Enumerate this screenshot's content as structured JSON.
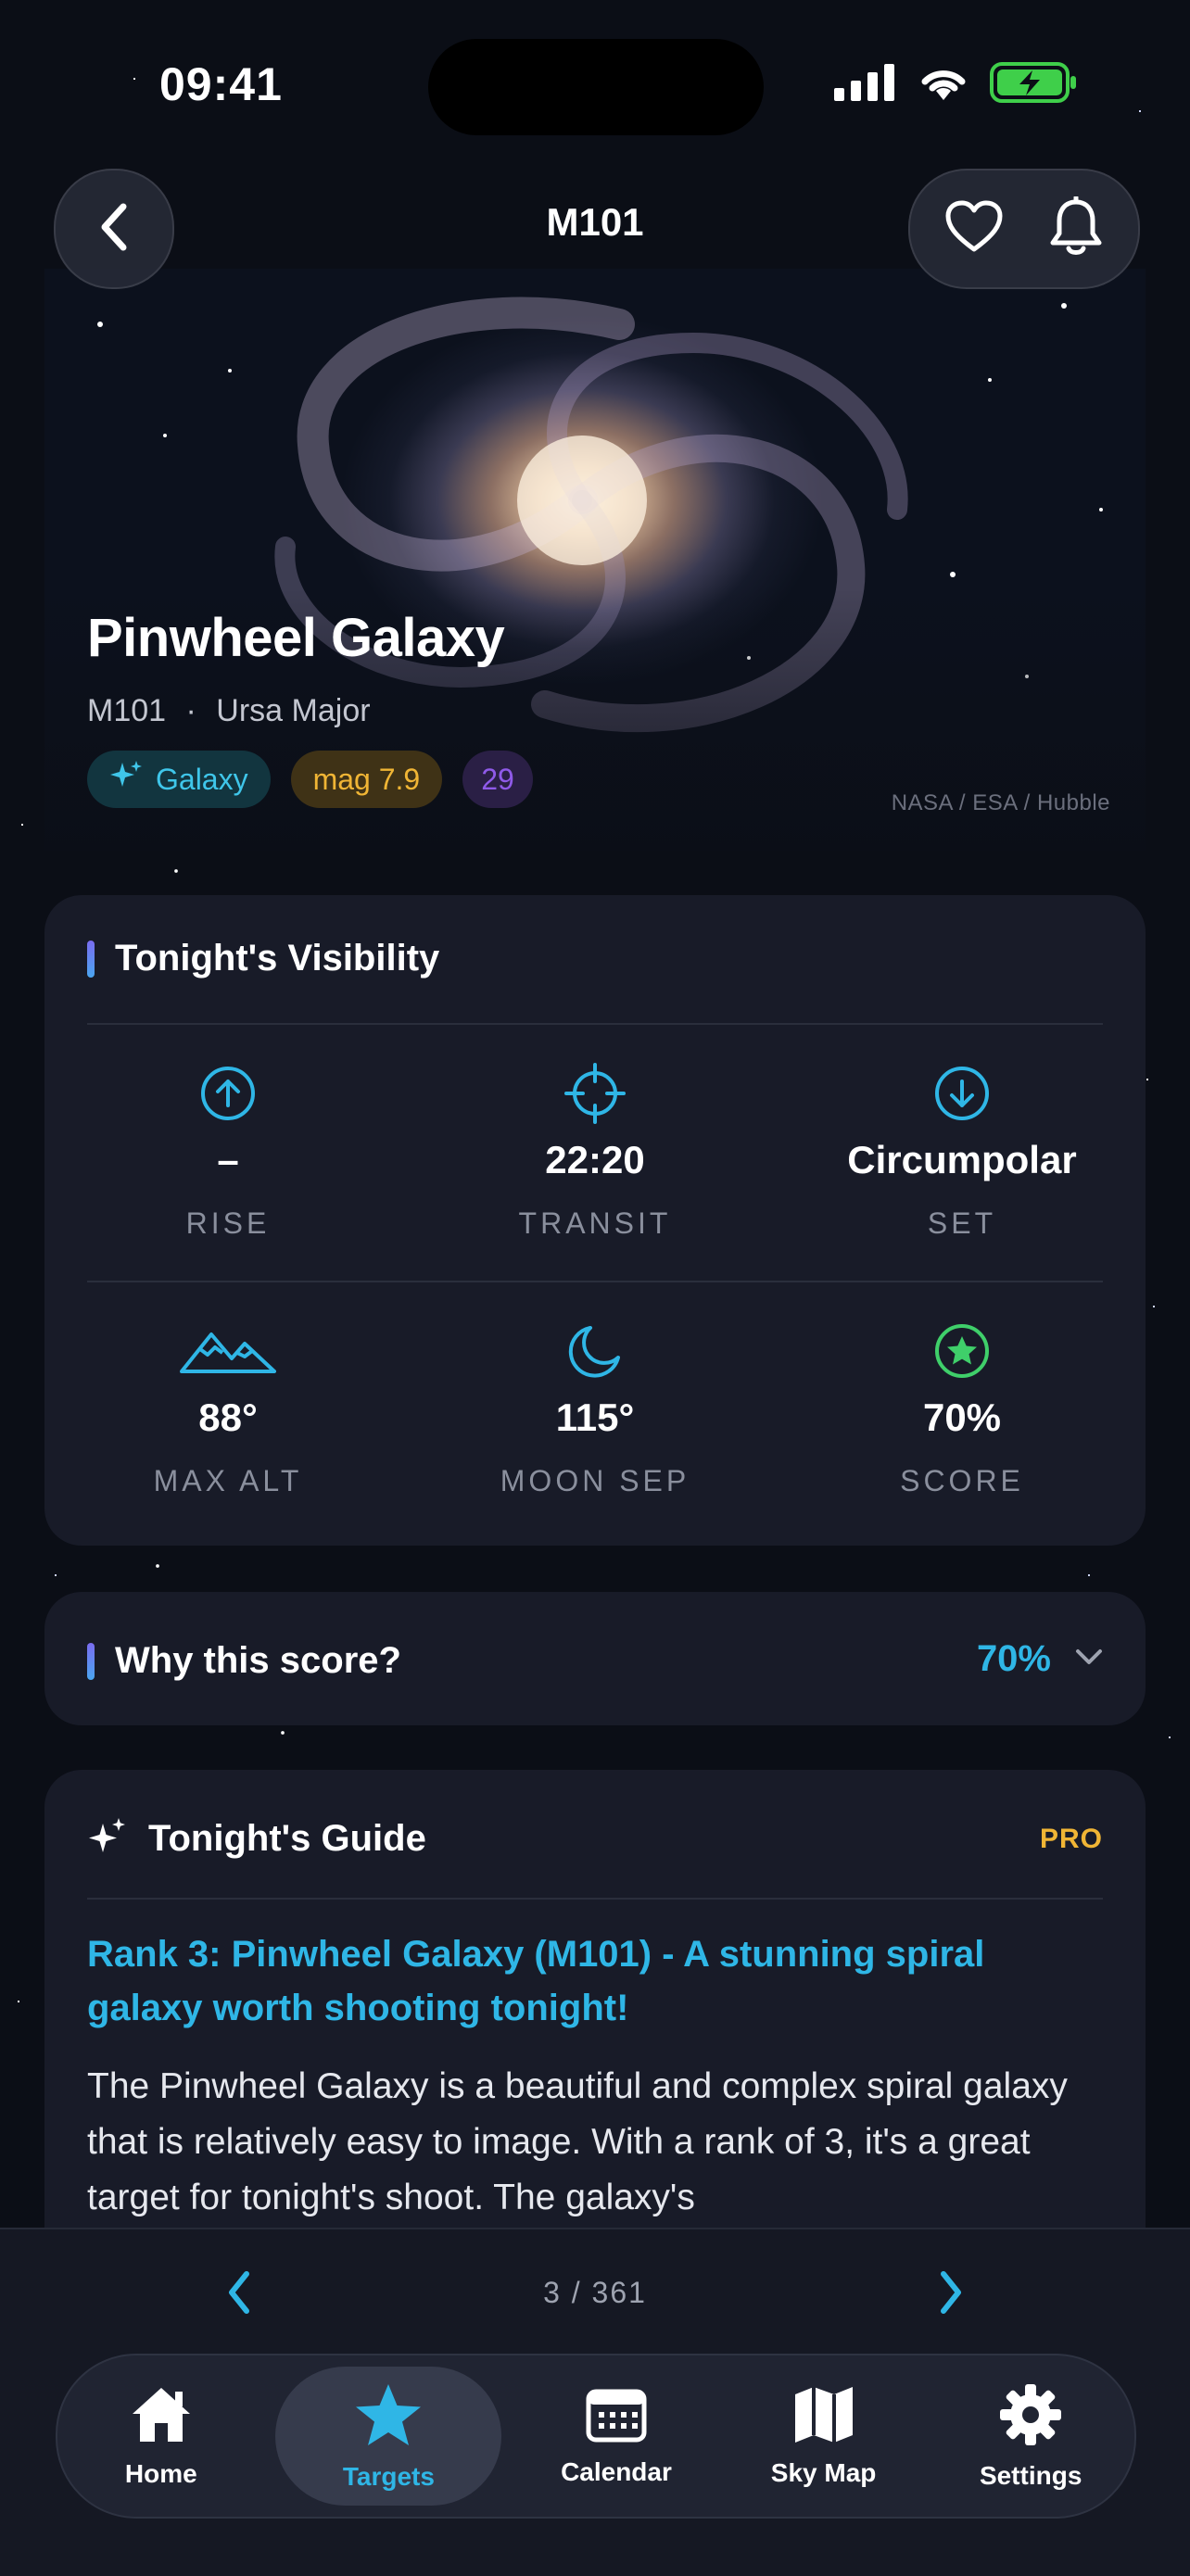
{
  "status_bar": {
    "time": "09:41"
  },
  "nav": {
    "title": "M101",
    "back_icon": "chevron-left-icon",
    "favorite_icon": "heart-icon",
    "alert_icon": "bell-icon"
  },
  "hero": {
    "title": "Pinwheel Galaxy",
    "catalog_id": "M101",
    "separator": "·",
    "constellation": "Ursa Major",
    "chips": {
      "type": "Galaxy",
      "magnitude": "mag 7.9",
      "third": "29"
    },
    "credit": "NASA / ESA / Hubble"
  },
  "visibility": {
    "title": "Tonight's Visibility",
    "row1": [
      {
        "value": "–",
        "label": "RISE",
        "icon": "arrow-up-circle-icon"
      },
      {
        "value": "22:20",
        "label": "TRANSIT",
        "icon": "crosshair-icon"
      },
      {
        "value": "Circumpolar",
        "label": "SET",
        "icon": "arrow-down-circle-icon"
      }
    ],
    "row2": [
      {
        "value": "88°",
        "label": "MAX ALT",
        "icon": "mountain-icon"
      },
      {
        "value": "115°",
        "label": "MOON SEP",
        "icon": "moon-icon"
      },
      {
        "value": "70%",
        "label": "SCORE",
        "icon": "star-circle-icon"
      }
    ]
  },
  "score_section": {
    "title": "Why this score?",
    "value": "70%"
  },
  "guide": {
    "title": "Tonight's Guide",
    "badge": "PRO",
    "headline": "Rank 3: Pinwheel Galaxy (M101) - A stunning spiral galaxy worth shooting tonight!",
    "body": "The Pinwheel Galaxy is a beautiful and complex spiral galaxy that is relatively easy to image. With a rank of 3, it's a great target for tonight's shoot. The galaxy's"
  },
  "pager": {
    "text": "3 / 361"
  },
  "tabs": [
    {
      "label": "Home",
      "icon": "home-icon"
    },
    {
      "label": "Targets",
      "icon": "star-icon",
      "active": true
    },
    {
      "label": "Calendar",
      "icon": "calendar-icon"
    },
    {
      "label": "Sky Map",
      "icon": "map-icon"
    },
    {
      "label": "Settings",
      "icon": "gear-icon"
    }
  ],
  "colors": {
    "accent": "#2fb6e6",
    "pro": "#f0b535",
    "background": "#0b0e16",
    "card": "#181b28",
    "score_icon": "#3fcf6a"
  }
}
